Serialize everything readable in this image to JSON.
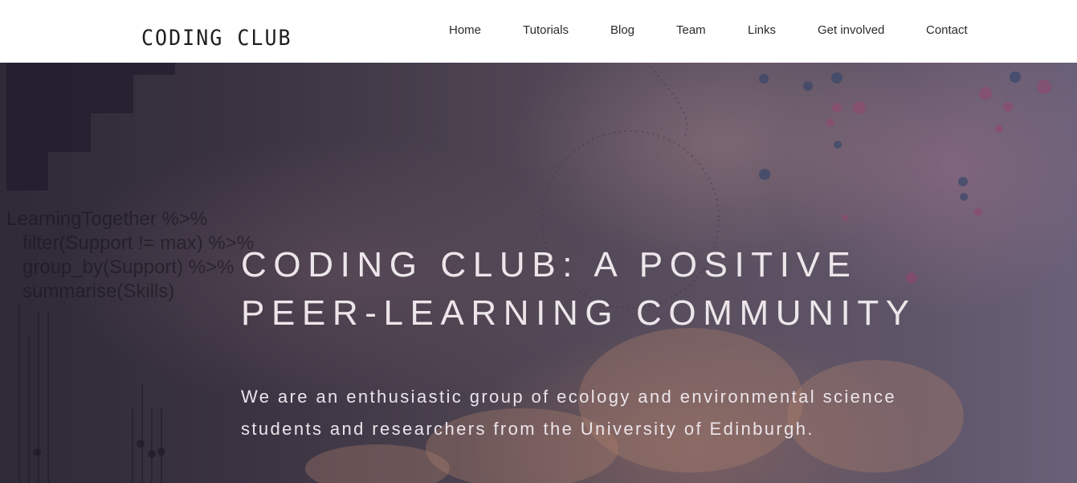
{
  "header": {
    "logo_text": "CODING CLUB",
    "nav": [
      {
        "label": "Home"
      },
      {
        "label": "Tutorials"
      },
      {
        "label": "Blog"
      },
      {
        "label": "Team"
      },
      {
        "label": "Links"
      },
      {
        "label": "Get involved"
      },
      {
        "label": "Contact"
      }
    ]
  },
  "hero": {
    "title_line1": "CODING CLUB: A POSITIVE",
    "title_line2": "PEER-LEARNING COMMUNITY",
    "subtitle_line1": "We are an enthusiastic group of ecology and environmental science",
    "subtitle_line2": "students and researchers from the University of Edinburgh.",
    "background_code": [
      "LearningTogether %>%",
      "   filter(Support != max) %>%",
      "   group_by(Support) %>%",
      "   summarise(Skills)"
    ]
  },
  "colors": {
    "header_bg": "#ffffff",
    "nav_text": "#2b2b2b",
    "hero_text": "#ece6ea",
    "hero_tint": "#4c4250"
  }
}
